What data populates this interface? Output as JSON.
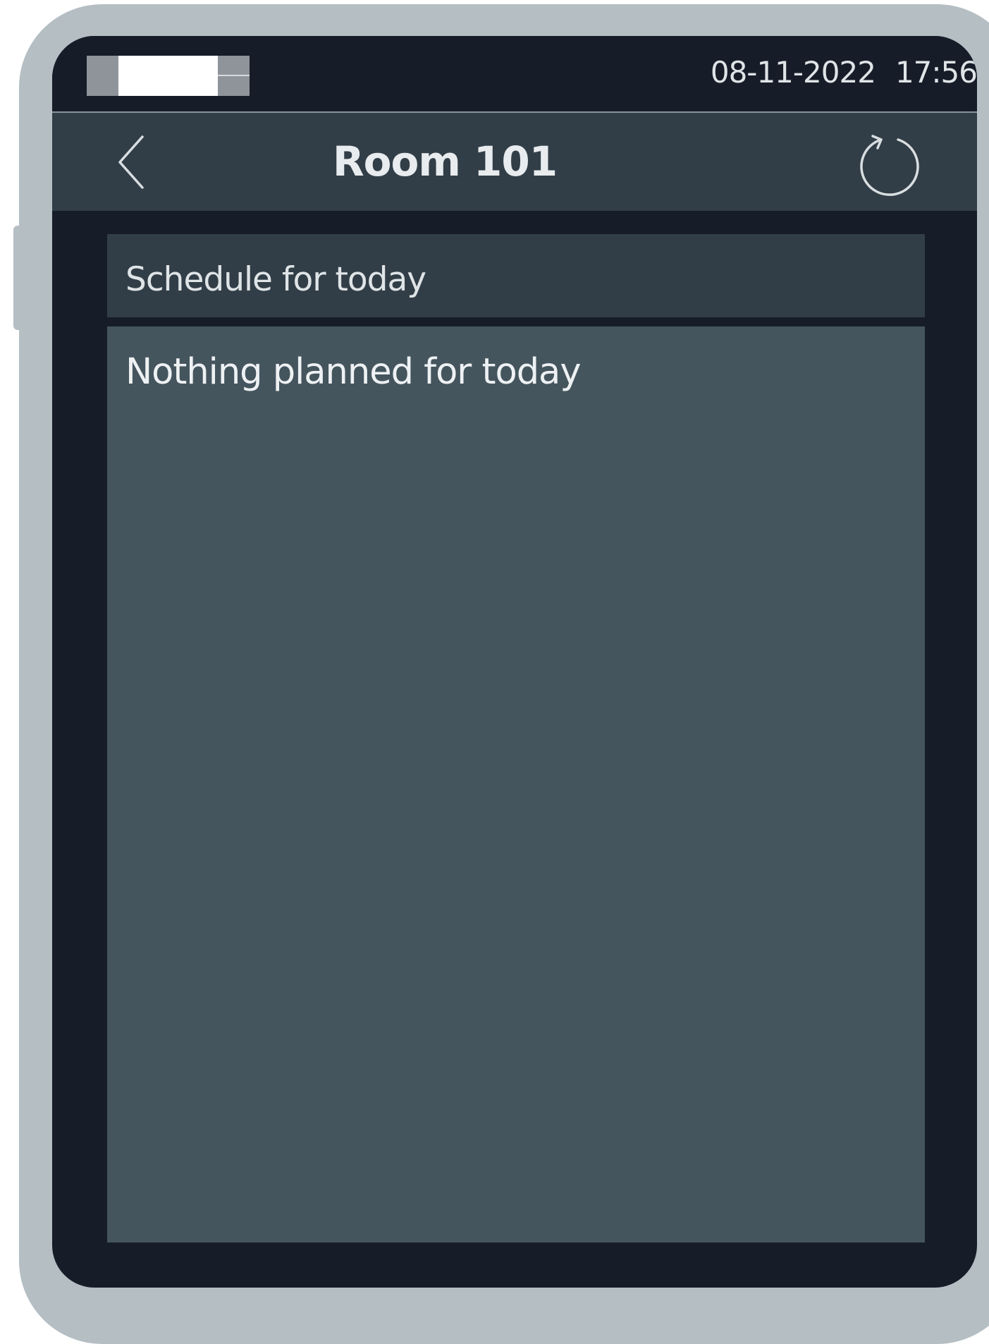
{
  "status_bar": {
    "date": "08-11-2022",
    "time": "17:56"
  },
  "header": {
    "title": "Room 101",
    "back_icon": "chevron-left-icon",
    "refresh_icon": "refresh-icon"
  },
  "schedule": {
    "heading": "Schedule for today",
    "empty_message": "Nothing planned for today"
  },
  "colors": {
    "device_frame": "#b4bec3",
    "screen_background": "#161d29",
    "title_bar": "#323e47",
    "schedule_body": "#45555e",
    "text": "#dfe4e7"
  }
}
